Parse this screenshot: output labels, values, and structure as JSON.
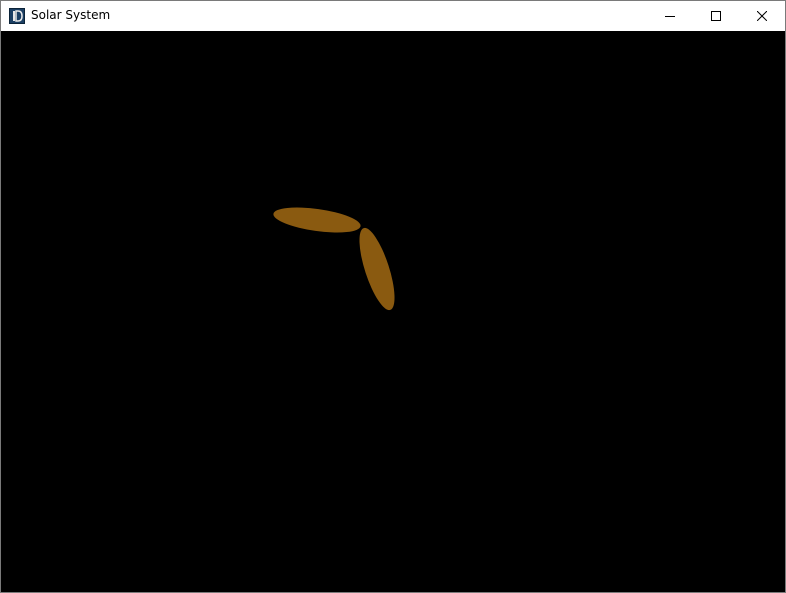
{
  "window": {
    "title": "Solar System",
    "app_icon": "app-logo-icon",
    "controls": {
      "minimize_icon": "minimize-icon",
      "maximize_icon": "maximize-icon",
      "close_icon": "close-icon"
    }
  },
  "scene": {
    "background_color": "#000000",
    "body_color": "#8a5a10",
    "bodies": [
      "orbiting-body-1",
      "orbiting-body-2"
    ]
  }
}
